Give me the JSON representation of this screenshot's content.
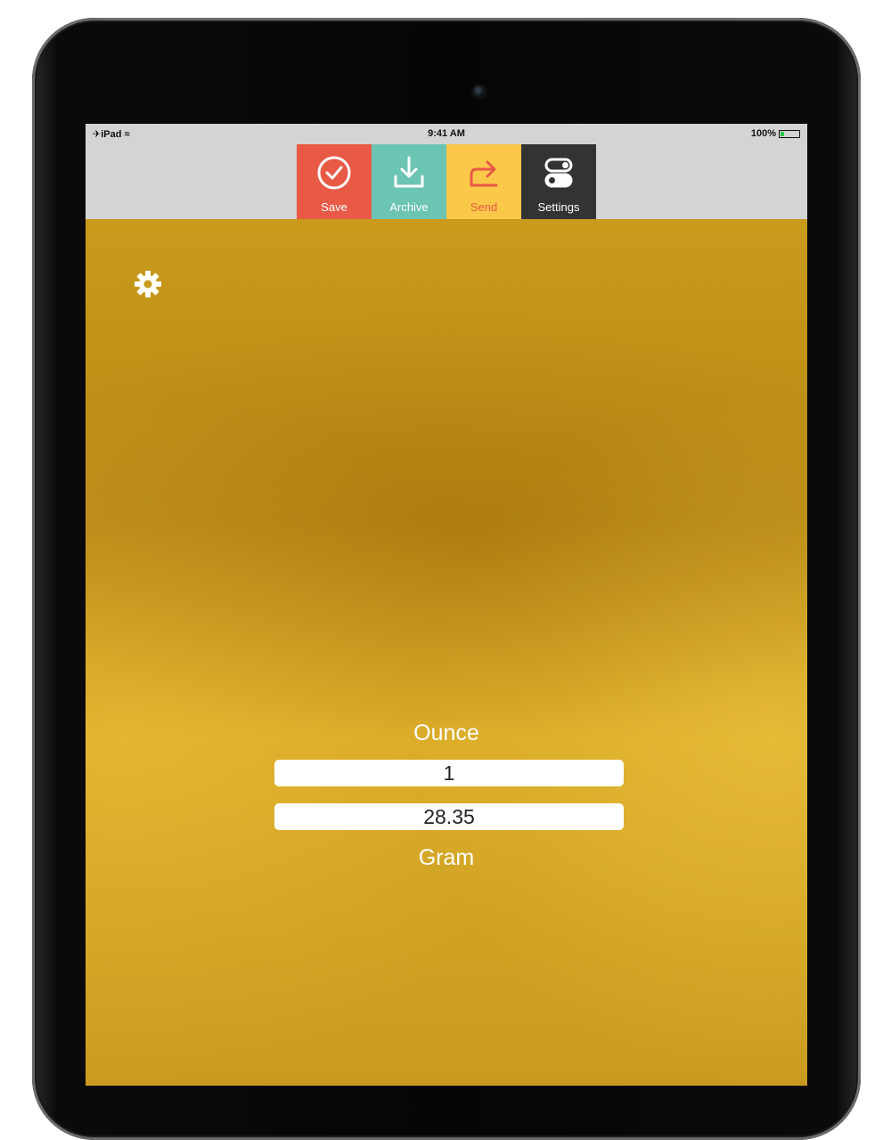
{
  "status_bar": {
    "carrier": "iPad",
    "time": "9:41 AM",
    "battery_text": "100%",
    "battery_level": 0.2,
    "battery_color": "#2cc84a"
  },
  "toolbar": {
    "buttons": [
      {
        "label": "Save",
        "icon": "checkmark-circle-icon",
        "color": "#e85a45"
      },
      {
        "label": "Archive",
        "icon": "download-tray-icon",
        "color": "#6cc4b2"
      },
      {
        "label": "Send",
        "icon": "share-arrow-icon",
        "color": "#fcc84a"
      },
      {
        "label": "Settings",
        "icon": "toggle-switches-icon",
        "color": "#333333"
      }
    ]
  },
  "converter": {
    "from_unit": "Ounce",
    "from_value": "1",
    "to_unit": "Gram",
    "to_value": "28.35"
  },
  "theme": {
    "background": "#c99a1c"
  }
}
